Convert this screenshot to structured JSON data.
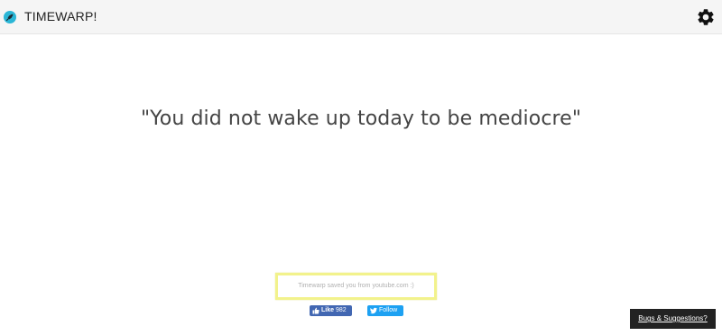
{
  "header": {
    "app_title": "TIMEWARP!",
    "logo_icon": "rocket-icon",
    "settings_icon": "gear-icon"
  },
  "main": {
    "quote": "\"You did not wake up today to be mediocre\""
  },
  "notice": {
    "text": "Timewarp saved you from youtube.com :)"
  },
  "social": {
    "facebook": {
      "icon": "thumbs-up-icon",
      "label": "Like",
      "count": "982",
      "color": "#4267b2"
    },
    "twitter": {
      "icon": "twitter-bird-icon",
      "label": "Follow",
      "color": "#1da1f2"
    }
  },
  "footer": {
    "bugs_label": "Bugs & Suggestions?"
  },
  "colors": {
    "accent": "#2ab6d6",
    "notice_border": "#f2f28c",
    "bugs_bg": "#222222"
  }
}
